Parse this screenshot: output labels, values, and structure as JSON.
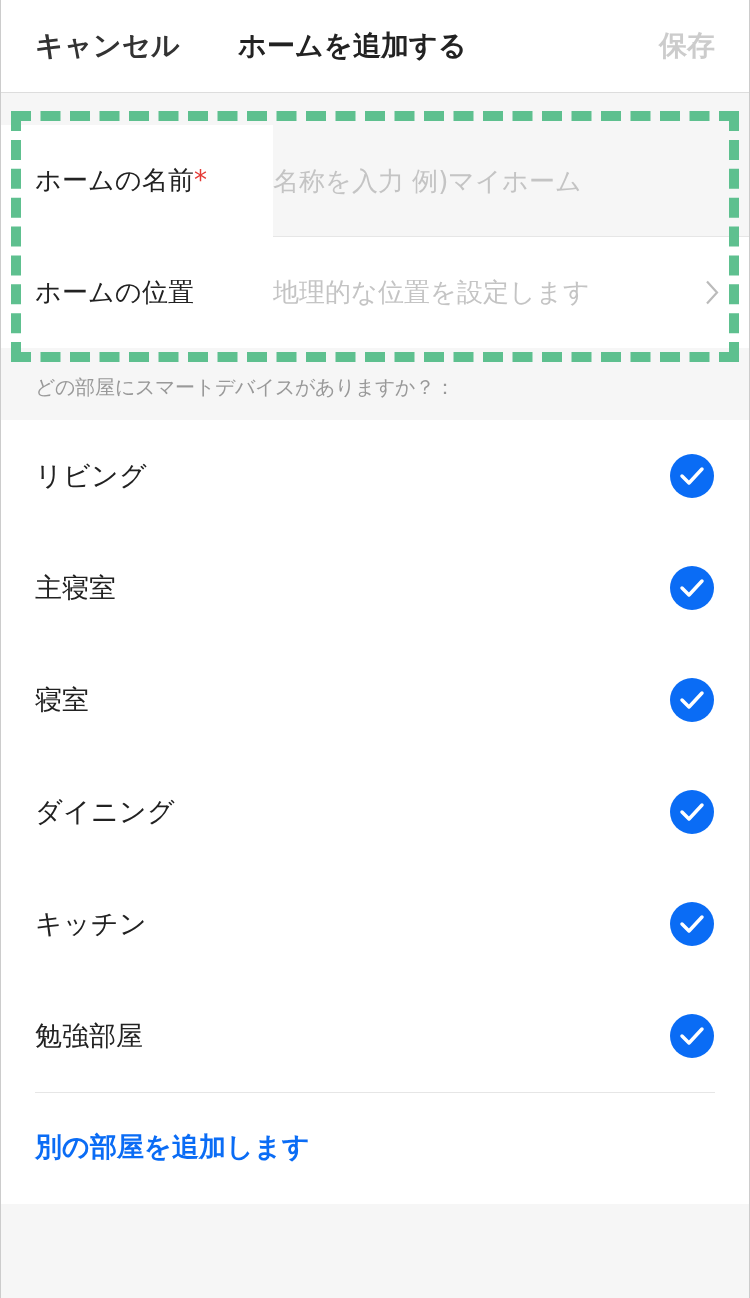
{
  "header": {
    "cancel": "キャンセル",
    "title": "ホームを追加する",
    "save": {
      "label": "保存",
      "disabled": true
    }
  },
  "form": {
    "highlighted": true,
    "fields": [
      {
        "kind": "text",
        "label": "ホームの名前",
        "required": true,
        "required_mark": "*",
        "placeholder": "名称を入力 例)マイホーム"
      },
      {
        "kind": "link",
        "label": "ホームの位置",
        "required": false,
        "placeholder": "地理的な位置を設定します"
      }
    ]
  },
  "rooms_label": "どの部屋にスマートデバイスがありますか？：",
  "rooms": [
    {
      "name": "リビング",
      "checked": true
    },
    {
      "name": "主寝室",
      "checked": true
    },
    {
      "name": "寝室",
      "checked": true
    },
    {
      "name": "ダイニング",
      "checked": true
    },
    {
      "name": "キッチン",
      "checked": true
    },
    {
      "name": "勉強部屋",
      "checked": true
    }
  ],
  "add_room": "別の部屋を追加します"
}
